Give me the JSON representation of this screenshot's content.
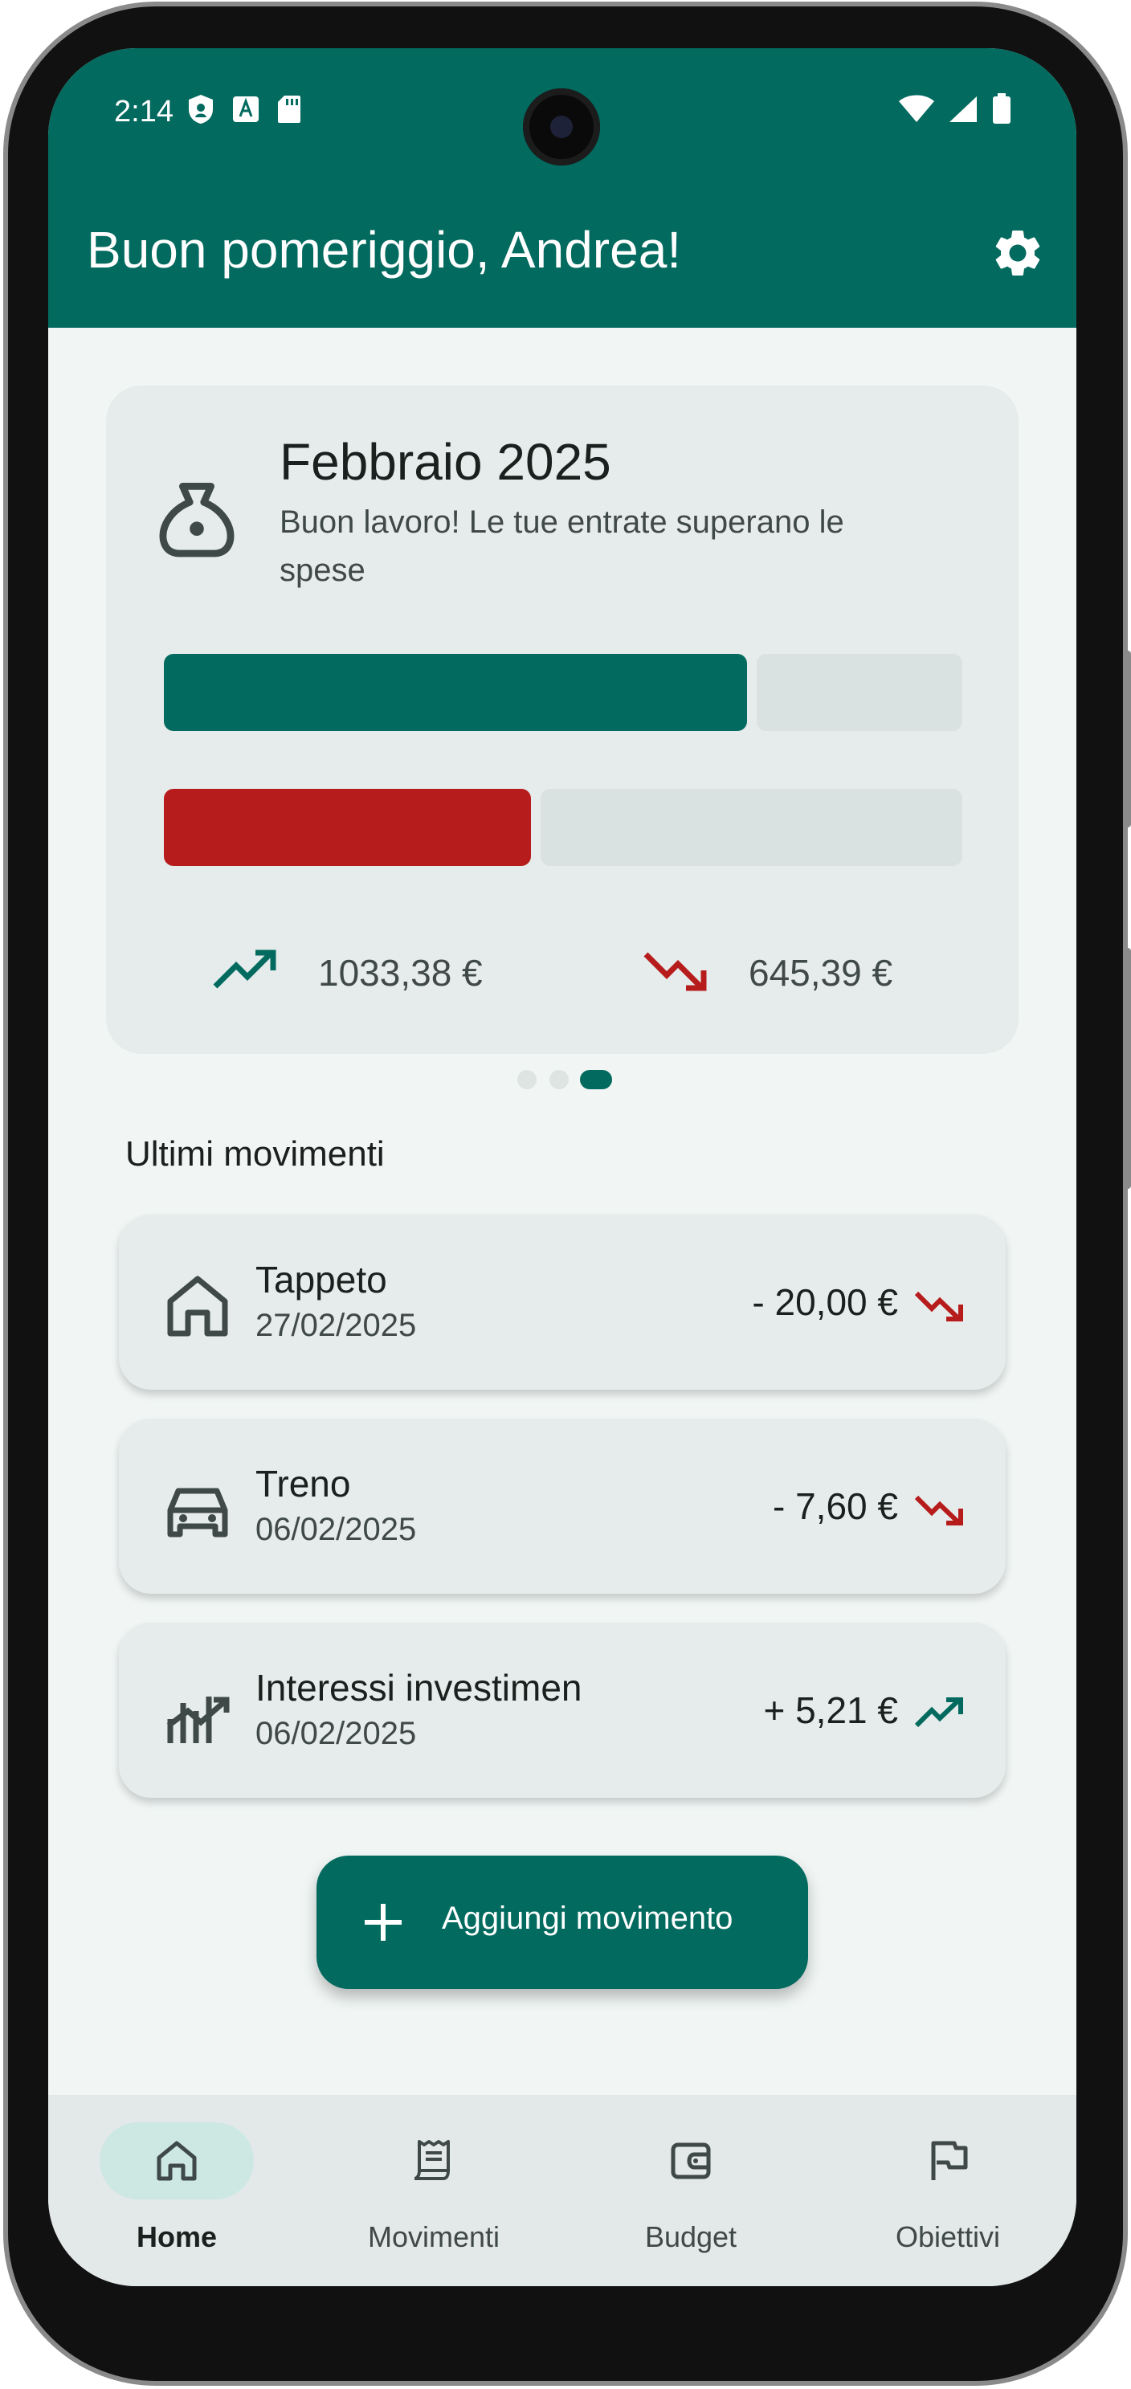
{
  "status_bar": {
    "time": "2:14",
    "left_icons": [
      "shield-icon",
      "translate-icon",
      "sd-card-icon"
    ],
    "right_icons": [
      "wifi-icon",
      "signal-icon",
      "battery-icon"
    ]
  },
  "header": {
    "greeting": "Buon pomeriggio, Andrea!",
    "settings_icon": "gear-icon"
  },
  "summary": {
    "title": "Febbraio 2025",
    "subtitle": "Buon lavoro! Le tue entrate superano le spese",
    "income_bar_fraction": 0.73,
    "expense_bar_fraction": 0.46,
    "income_total": "1033,38 €",
    "expense_total": "645,39 €",
    "pager": {
      "count": 3,
      "active": 2
    }
  },
  "recent": {
    "title": "Ultimi movimenti",
    "items": [
      {
        "name": "Tappeto",
        "date": "27/02/2025",
        "amount": "- 20,00 €",
        "icon": "home-icon",
        "trend": "down"
      },
      {
        "name": "Treno",
        "date": "06/02/2025",
        "amount": "- 7,60 €",
        "icon": "car-icon",
        "trend": "down"
      },
      {
        "name": "Interessi investimen",
        "date": "06/02/2025",
        "amount": "+ 5,21 €",
        "icon": "chart-icon",
        "trend": "up"
      }
    ]
  },
  "fab": {
    "label": "Aggiungi movimento"
  },
  "nav": {
    "items": [
      {
        "label": "Home",
        "icon": "home-icon",
        "active": true
      },
      {
        "label": "Movimenti",
        "icon": "receipt-icon",
        "active": false
      },
      {
        "label": "Budget",
        "icon": "wallet-icon",
        "active": false
      },
      {
        "label": "Obiettivi",
        "icon": "flag-icon",
        "active": false
      }
    ]
  },
  "colors": {
    "primary": "#026a5e",
    "expense": "#b71c1c",
    "surface": "#e6eceb",
    "track": "#d9e2e0",
    "nav_active_pill": "#cde8e3"
  }
}
